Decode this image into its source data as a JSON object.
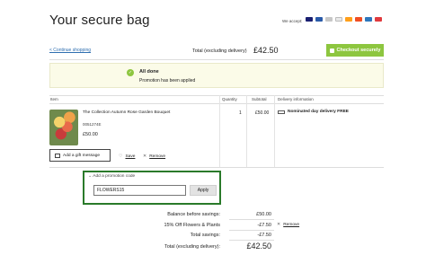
{
  "header": {
    "title": "Your secure bag",
    "accept_label": "We accept:",
    "payment_cards": [
      {
        "icon": "card-icon",
        "color": "#1a1f71"
      },
      {
        "icon": "card-icon",
        "color": "#2a5aa8"
      },
      {
        "icon": "card-icon",
        "color": "#c7c7c7"
      },
      {
        "icon": "card-icon",
        "color": "#e8e8e8"
      },
      {
        "icon": "card-icon",
        "color": "#ff9f1a"
      },
      {
        "icon": "card-icon",
        "color": "#f04e23"
      },
      {
        "icon": "card-icon",
        "color": "#2e77bc"
      },
      {
        "icon": "card-icon",
        "color": "#e03a3e"
      }
    ]
  },
  "toolbar": {
    "continue_label": "< Continue shopping",
    "total_label": "Total (excluding delivery)",
    "total_value": "£42.50",
    "checkout_label": "Checkout securely"
  },
  "notice": {
    "title": "All done",
    "message": "Promotion has been applied"
  },
  "table": {
    "headers": [
      "Item",
      "Quantity",
      "Subtotal",
      "Delivery information"
    ]
  },
  "item": {
    "name": "The Collection Autumn Rose Garden Bouquet",
    "sku": "0051274E",
    "price": "£50.00",
    "quantity": "1",
    "subtotal": "£50.00",
    "delivery": "Nominated day delivery FREE",
    "gift_label": "Add a gift message",
    "save_label": "Save",
    "remove_label": "Remove"
  },
  "promo": {
    "title": "Add a promotion code",
    "input_value": "FLOWERS15",
    "apply_label": "Apply"
  },
  "summary": {
    "rows": [
      {
        "label": "Balance before savings:",
        "value": "£50.00"
      },
      {
        "label": "15% Off Flowers & Plants",
        "value": "-£7.50"
      },
      {
        "label": "Total savings:",
        "value": "-£7.50"
      },
      {
        "label": "Total (excluding delivery):",
        "value": "£42.50"
      }
    ],
    "remove_label": "Remove"
  },
  "colors": {
    "accent_green": "#8dc63f",
    "promo_border": "#2a7a2a",
    "link_blue": "#2f6fb0"
  }
}
